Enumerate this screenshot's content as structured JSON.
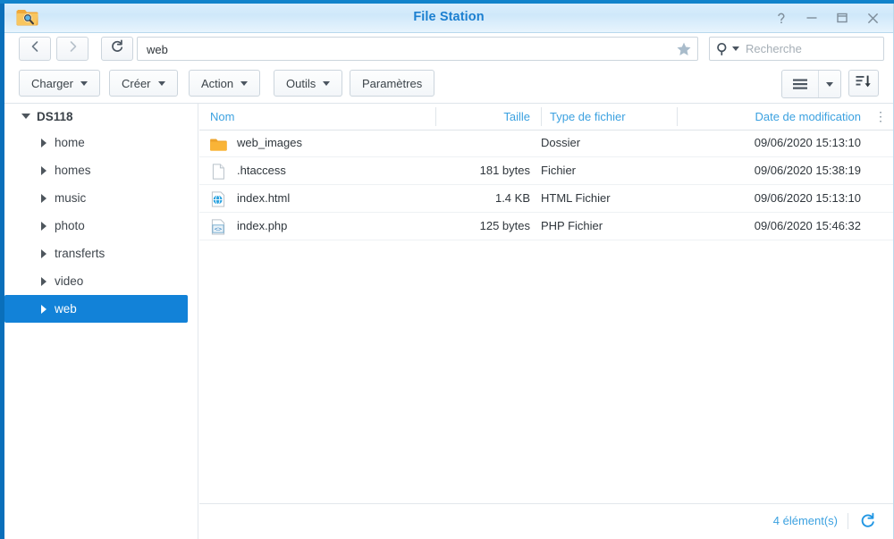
{
  "window": {
    "title": "File Station",
    "app_icon": "folder-search-icon",
    "controls": {
      "help": "?",
      "minimize": "minimize-icon",
      "maximize": "maximize-icon",
      "close": "close-icon"
    }
  },
  "navbar": {
    "back_icon": "chevron-left-icon",
    "forward_icon": "chevron-right-icon",
    "refresh_icon": "refresh-icon",
    "path_value": "web",
    "path_placeholder": "",
    "favorite_icon": "star-icon",
    "search_placeholder": "Recherche",
    "search_icon": "search-icon"
  },
  "toolbar": {
    "buttons": [
      {
        "label": "Charger",
        "has_caret": true
      },
      {
        "label": "Créer",
        "has_caret": true
      },
      {
        "label": "Action",
        "has_caret": true
      },
      {
        "label": "Outils",
        "has_caret": true
      },
      {
        "label": "Paramètres",
        "has_caret": false
      }
    ],
    "view_icon": "list-view-icon",
    "view_caret_icon": "chevron-down-icon",
    "sort_icon": "sort-descending-icon"
  },
  "sidebar": {
    "root": {
      "label": "DS118",
      "expanded": true
    },
    "items": [
      {
        "label": "home",
        "selected": false
      },
      {
        "label": "homes",
        "selected": false
      },
      {
        "label": "music",
        "selected": false
      },
      {
        "label": "photo",
        "selected": false
      },
      {
        "label": "transferts",
        "selected": false
      },
      {
        "label": "video",
        "selected": false
      },
      {
        "label": "web",
        "selected": true
      }
    ]
  },
  "filelist": {
    "columns": {
      "name": "Nom",
      "size": "Taille",
      "type": "Type de fichier",
      "date": "Date de modification",
      "menu_icon": "column-options-icon"
    },
    "rows": [
      {
        "name": "web_images",
        "size": "",
        "type": "Dossier",
        "date": "09/06/2020 15:13:10",
        "icon": "folder-icon"
      },
      {
        "name": ".htaccess",
        "size": "181 bytes",
        "type": "Fichier",
        "date": "09/06/2020 15:38:19",
        "icon": "file-icon"
      },
      {
        "name": "index.html",
        "size": "1.4 KB",
        "type": "HTML Fichier",
        "date": "09/06/2020 15:13:10",
        "icon": "html-file-icon"
      },
      {
        "name": "index.php",
        "size": "125 bytes",
        "type": "PHP Fichier",
        "date": "09/06/2020 15:46:32",
        "icon": "php-file-icon"
      }
    ]
  },
  "statusbar": {
    "count_label": "4 élément(s)",
    "refresh_icon": "refresh-icon"
  },
  "colors": {
    "accent_blue": "#1282d8",
    "header_link": "#3ba1e0",
    "title_blue": "#1b7fd0",
    "folder_orange": "#f5a623"
  }
}
